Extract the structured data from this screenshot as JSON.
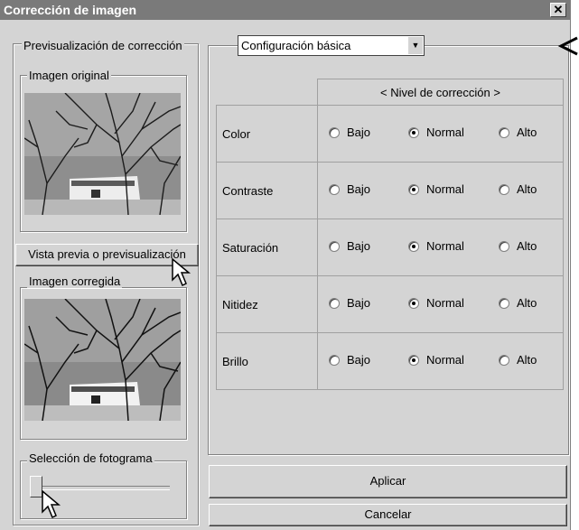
{
  "window": {
    "title": "Corrección de imagen",
    "close_symbol": "✕"
  },
  "preview": {
    "group_label": "Previsualización de corrección",
    "original_label": "Imagen original",
    "preview_button_label": "Vista previa o previsualización",
    "corrected_label": "Imagen corregida"
  },
  "frame": {
    "group_label": "Selección de fotograma"
  },
  "settings": {
    "selected_value": "Configuración básica"
  },
  "grid": {
    "header": "< Nivel de corrección >",
    "option_labels": {
      "low": "Bajo",
      "normal": "Normal",
      "high": "Alto"
    },
    "rows": [
      {
        "label": "Color",
        "selected": "Normal"
      },
      {
        "label": "Contraste",
        "selected": "Normal"
      },
      {
        "label": "Saturación",
        "selected": "Normal"
      },
      {
        "label": "Nitidez",
        "selected": "Normal"
      },
      {
        "label": "Brillo",
        "selected": "Normal"
      }
    ]
  },
  "buttons": {
    "apply": "Aplicar",
    "cancel": "Cancelar"
  },
  "colors": {
    "title_bar": "#7a7a7a",
    "window_bg": "#d4d4d4"
  }
}
